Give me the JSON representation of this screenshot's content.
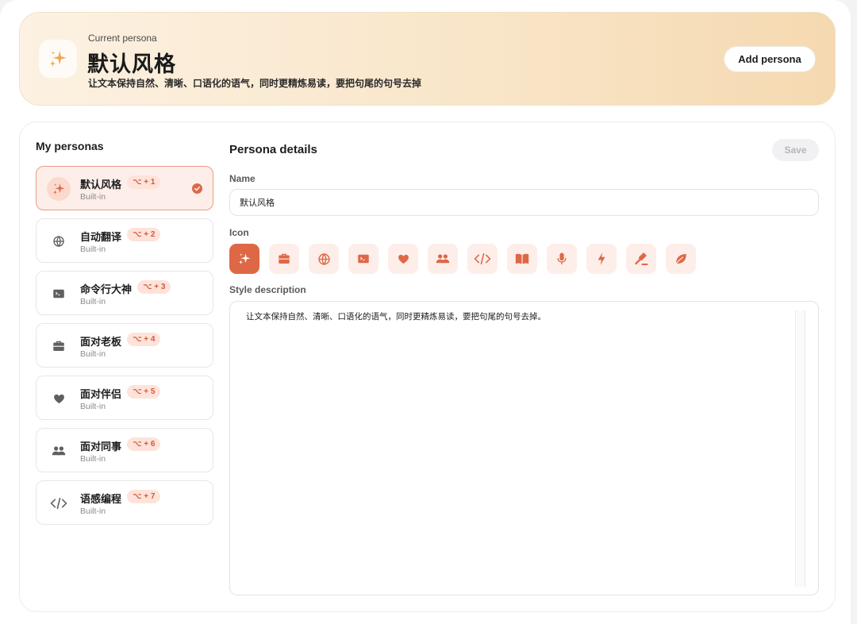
{
  "header": {
    "subtitle": "Current persona",
    "title": "默认风格",
    "description": "让文本保持自然、清晰、口语化的语气，同时更精炼易读，要把句尾的句号去掉",
    "add_button": "Add persona",
    "icon": "sparkles-icon"
  },
  "sidebar": {
    "title": "My personas",
    "items": [
      {
        "name": "默认风格",
        "badge": "⌥ + 1",
        "sub": "Built-in",
        "icon": "sparkles-icon",
        "active": true
      },
      {
        "name": "自动翻译",
        "badge": "⌥ + 2",
        "sub": "Built-in",
        "icon": "globe-icon"
      },
      {
        "name": "命令行大神",
        "badge": "⌥ + 3",
        "sub": "Built-in",
        "icon": "terminal-icon"
      },
      {
        "name": "面对老板",
        "badge": "⌥ + 4",
        "sub": "Built-in",
        "icon": "briefcase-icon"
      },
      {
        "name": "面对伴侣",
        "badge": "⌥ + 5",
        "sub": "Built-in",
        "icon": "heart-icon"
      },
      {
        "name": "面对同事",
        "badge": "⌥ + 6",
        "sub": "Built-in",
        "icon": "people-icon"
      },
      {
        "name": "语感编程",
        "badge": "⌥ + 7",
        "sub": "Built-in",
        "icon": "code-icon"
      }
    ]
  },
  "details": {
    "title": "Persona details",
    "save_label": "Save",
    "name_label": "Name",
    "name_value": "默认风格",
    "icon_label": "Icon",
    "icons": [
      "sparkles-icon",
      "briefcase-icon",
      "globe-icon",
      "terminal-icon",
      "heart-icon",
      "people-icon",
      "code-icon",
      "book-icon",
      "microphone-icon",
      "bolt-icon",
      "gavel-icon",
      "leaf-icon"
    ],
    "selected_icon": "sparkles-icon",
    "style_label": "Style description",
    "style_value": "让文本保持自然、清晰、口语化的语气，同时更精炼易读，要把句尾的句号去掉。"
  },
  "colors": {
    "accent": "#de6846",
    "accent_soft": "#fdeee9",
    "badge_text": "#d8583a",
    "icon_gray": "#5f5f5f"
  }
}
